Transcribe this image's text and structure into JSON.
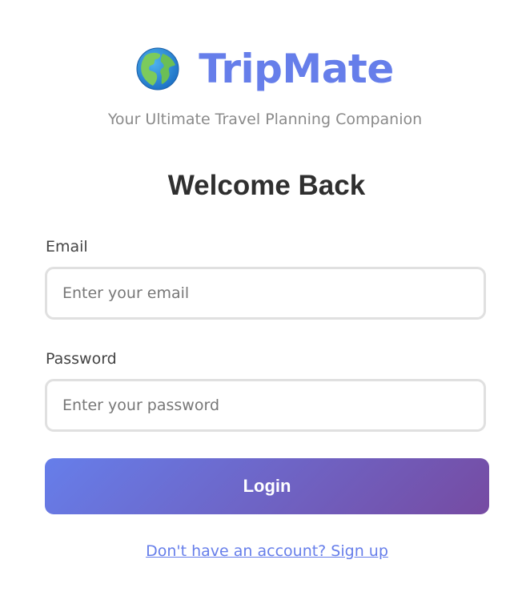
{
  "brand": {
    "icon": "globe-europe-africa-icon",
    "name": "TripMate",
    "tagline": "Your Ultimate Travel Planning Companion",
    "color": "#667eea"
  },
  "form": {
    "heading": "Welcome Back",
    "email": {
      "label": "Email",
      "placeholder": "Enter your email",
      "value": ""
    },
    "password": {
      "label": "Password",
      "placeholder": "Enter your password",
      "value": ""
    },
    "submit_label": "Login",
    "signup_link": "Don't have an account? Sign up"
  },
  "colors": {
    "gradient_start": "#667eea",
    "gradient_end": "#764ba2",
    "input_border": "#e0e0e0"
  }
}
